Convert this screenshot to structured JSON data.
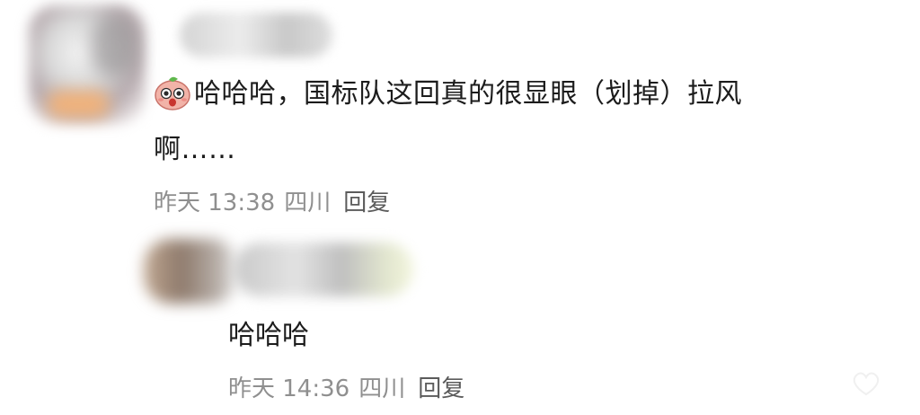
{
  "comment": {
    "emoji": "surprised-peach-emoji",
    "text_line1": "哈哈哈，国标队这回真的很显眼（划掉）拉风",
    "text_line2": "啊……",
    "time": "昨天 13:38",
    "location": "四川",
    "reply_label": "回复"
  },
  "reply": {
    "text": "哈哈哈",
    "time": "昨天 14:36",
    "location": "四川",
    "reply_label": "回复"
  }
}
